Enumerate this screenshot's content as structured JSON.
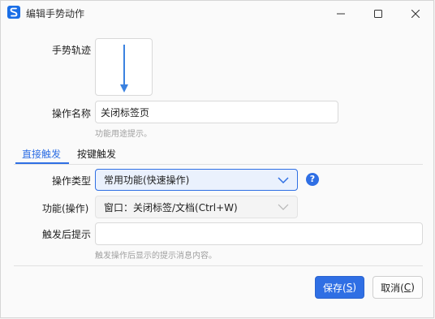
{
  "window": {
    "title": "编辑手势动作"
  },
  "form": {
    "gesture_label": "手势轨迹",
    "name_label": "操作名称",
    "name_value": "关闭标签页",
    "name_hint": "功能用途提示。"
  },
  "tabs": [
    {
      "label": "直接触发",
      "active": true
    },
    {
      "label": "按键触发",
      "active": false
    }
  ],
  "direct": {
    "op_type_label": "操作类型",
    "op_type_value": "常用功能(快速操作)",
    "function_label": "功能(操作)",
    "function_value": "窗口：关闭标签/文档(Ctrl+W)",
    "after_prompt_label": "触发后提示",
    "after_prompt_value": "",
    "after_prompt_hint": "触发操作后显示的提示消息内容。"
  },
  "buttons": {
    "save_label": "保存(",
    "save_key": "S",
    "save_suffix": ")",
    "cancel_label": "取消(",
    "cancel_key": "C",
    "cancel_suffix": ")"
  },
  "colors": {
    "accent": "#2f6fe4",
    "gesture_arrow": "#3b82e0"
  }
}
